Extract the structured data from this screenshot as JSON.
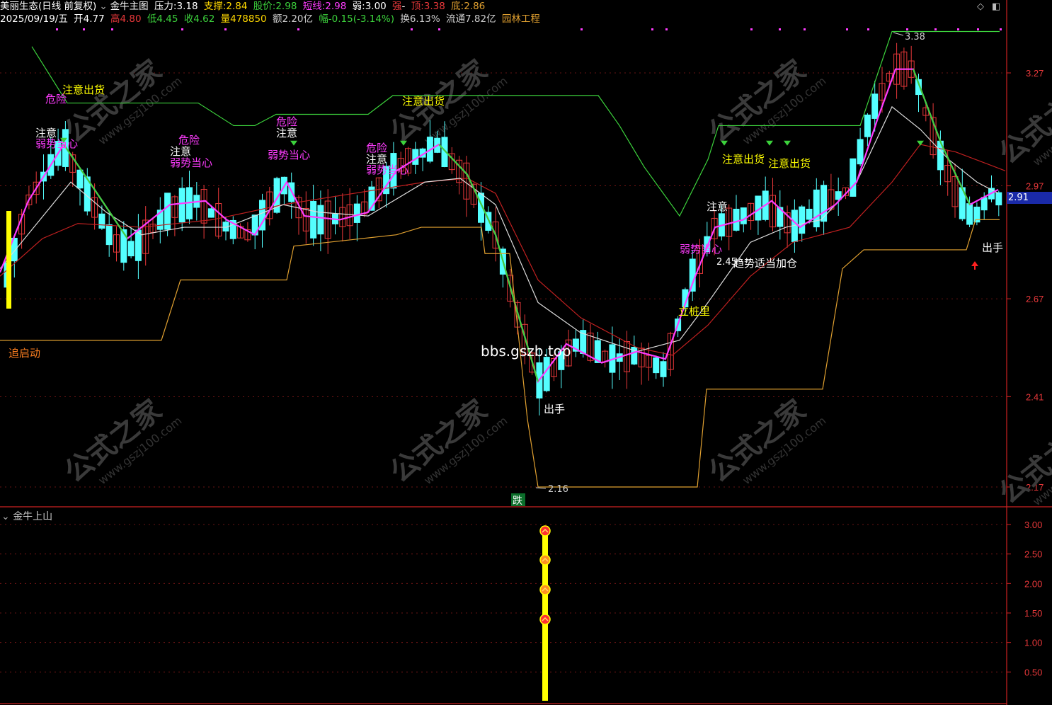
{
  "header1": {
    "stock": "美丽生态(日线 前复权)",
    "indicator": "金牛主图",
    "pressure_label": "压力:",
    "pressure": "3.18",
    "support_label": "支撑:",
    "support": "2.84",
    "price_label": "股价:",
    "price": "2.98",
    "short_label": "短线:",
    "short": "2.98",
    "weak_label": "弱:",
    "weak": "3.00",
    "strong_label": "强",
    "dash": "-",
    "top_label": "顶:",
    "top": "3.38",
    "bottom_label": "底:",
    "bottom": "2.86"
  },
  "header2": {
    "date": "2025/09/19/五",
    "open_label": "开",
    "open": "4.77",
    "high_label": "高",
    "high": "4.80",
    "low_label": "低",
    "low": "4.45",
    "close_label": "收",
    "close": "4.62",
    "vol_label": "量",
    "vol": "478850",
    "amt_label": "额",
    "amt": "2.20亿",
    "chg_label": "幅",
    "chg": "-0.15(-3.14%)",
    "turn_label": "换",
    "turn": "6.13%",
    "float_label": "流通",
    "float": "7.82亿",
    "sector": "园林工程"
  },
  "sub_title": "金牛上山",
  "price_badge": "2.91",
  "y_axis_main": [
    "3.27",
    "2.97",
    "2.67",
    "2.41",
    "2.17"
  ],
  "y_axis_sub": [
    "3.00",
    "2.50",
    "2.00",
    "1.50",
    "1.00",
    "0.50"
  ],
  "annotations": {
    "high_mark": "3.38",
    "low_mark": "2.16",
    "left_mark": "2.45",
    "watermark_site": "bbs.gszb.top",
    "zhui": "追启动",
    "die": "跌",
    "chushou": "出手",
    "lizhuang": "立桩里",
    "jiacang": "趋势适当加仓",
    "danger": "危险",
    "notice": "注意",
    "weak_care": "弱势当心",
    "sell_notice": "注意出货"
  },
  "watermark_brand": "公式之家",
  "watermark_url": "www.gszj100.com",
  "colors": {
    "up": "#e8383a",
    "down": "#54ffff",
    "green": "#3cd23c",
    "magenta": "#ff3cff",
    "white": "#ffffff",
    "orange": "#e0a030",
    "red": "#b22",
    "grid": "#8a1a1a",
    "yellow": "#ffff00"
  }
}
